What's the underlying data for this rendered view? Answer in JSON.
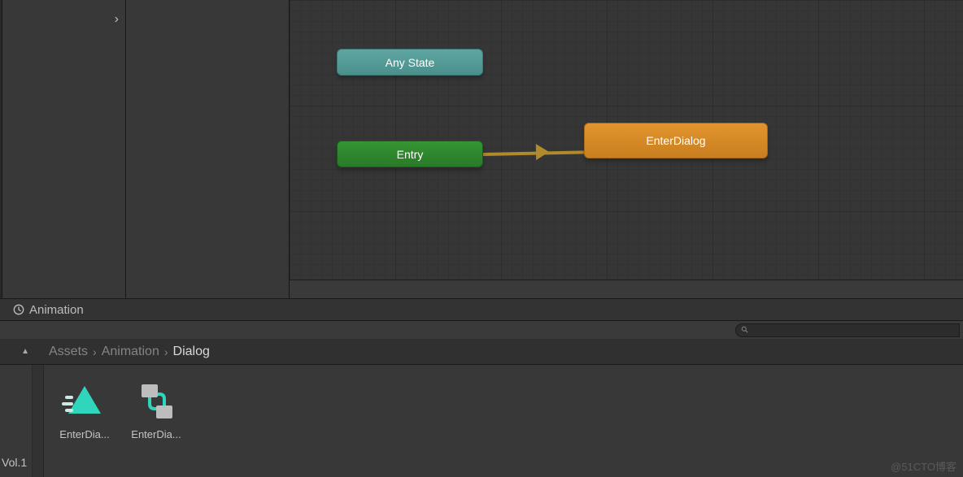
{
  "animator": {
    "nodes": {
      "anystate": "Any State",
      "entry": "Entry",
      "enterdialog": "EnterDialog"
    }
  },
  "tab": {
    "animation_label": "Animation"
  },
  "breadcrumbs": {
    "items": [
      "Assets",
      "Animation",
      "Dialog"
    ]
  },
  "assets": {
    "items": [
      {
        "label": "EnterDia...",
        "type": "anim"
      },
      {
        "label": "EnterDia...",
        "type": "controller"
      }
    ]
  },
  "footer": {
    "vol": "Vol.1"
  },
  "watermark": "@51CTO博客",
  "icons": {
    "clock": "clock-icon",
    "search": "search-icon",
    "chevron": "chevron-right-icon"
  }
}
